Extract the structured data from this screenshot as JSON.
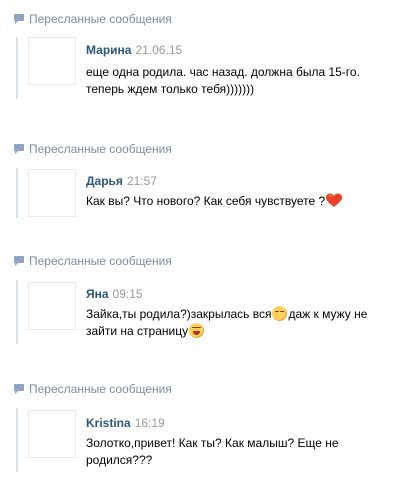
{
  "forwarded_label": "Пересланные сообщения",
  "messages": [
    {
      "author": "Марина",
      "time": "21.06.15",
      "lines": [
        "еще одна родила. час назад. должна была 15-го.",
        "теперь ждем только тебя)))))))"
      ]
    },
    {
      "author": "Дарья",
      "time": "21:57",
      "text": "Как вы? Что нового? Как себя чувствуете ?",
      "trailing_icon": "heart-icon"
    },
    {
      "author": "Яна",
      "time": "09:15",
      "line1_a": "Зайка,ты родила?)закрылась вся",
      "line1_icon": "relieved-emoji-icon",
      "line1_b": "даж к мужу не",
      "line2": "зайти на страницу",
      "line2_icon": "laughing-emoji-icon"
    },
    {
      "author": "Kristina",
      "time": "16:19",
      "lines": [
        "Золотко,привет! Как ты? Как малыш? Еще не",
        "родился???"
      ]
    }
  ],
  "colors": {
    "link": "#2b587a",
    "muted": "#7c8b9f",
    "bar": "#dae1e8",
    "time": "#999999",
    "heart": "#e8432a"
  }
}
